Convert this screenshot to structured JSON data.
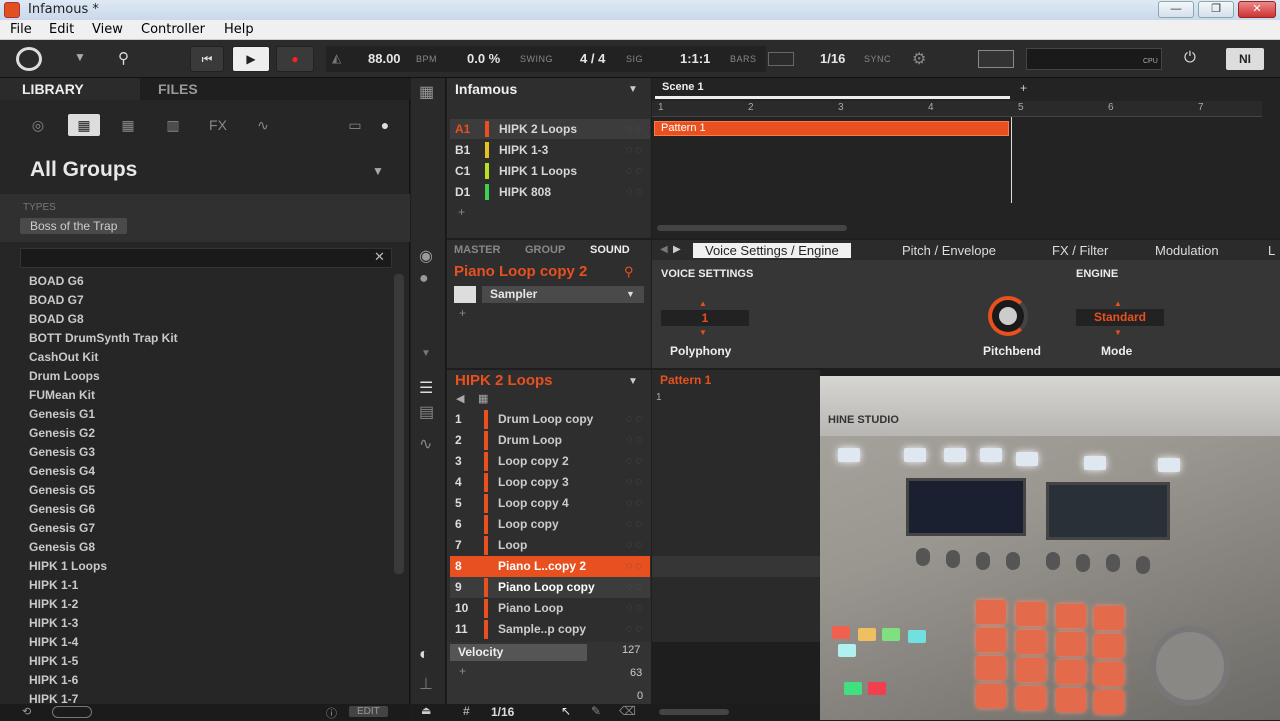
{
  "window": {
    "title": "Infamous *"
  },
  "menu": [
    "File",
    "Edit",
    "View",
    "Controller",
    "Help"
  ],
  "transport": {
    "bpm": "88.00",
    "bpm_label": "BPM",
    "swing": "0.0 %",
    "swing_label": "SWING",
    "sig": "4 / 4",
    "sig_label": "SIG",
    "bars": "1:1:1",
    "bars_label": "BARS",
    "sync": "1/16",
    "sync_label": "SYNC",
    "cpu_label": "CPU"
  },
  "library": {
    "tabs": [
      "LIBRARY",
      "FILES"
    ],
    "heading": "All Groups",
    "types_label": "TYPES",
    "type_tag": "Boss of the Trap",
    "items": [
      "BOAD G6",
      "BOAD G7",
      "BOAD G8",
      "BOTT DrumSynth Trap Kit",
      "CashOut Kit",
      "Drum Loops",
      "FUMean Kit",
      "Genesis G1",
      "Genesis G2",
      "Genesis G3",
      "Genesis G4",
      "Genesis G5",
      "Genesis G6",
      "Genesis G7",
      "Genesis G8",
      "HIPK 1 Loops",
      "HIPK 1-1",
      "HIPK 1-2",
      "HIPK 1-3",
      "HIPK 1-4",
      "HIPK 1-5",
      "HIPK 1-6",
      "HIPK 1-7"
    ],
    "edit_label": "EDIT"
  },
  "project": {
    "title": "Infamous",
    "groups": [
      {
        "id": "A1",
        "name": "HIPK 2 Loops",
        "color": "#e8501f"
      },
      {
        "id": "B1",
        "name": "HIPK 1-3",
        "color": "#e8c01f"
      },
      {
        "id": "C1",
        "name": "HIPK 1 Loops",
        "color": "#b8e01f"
      },
      {
        "id": "D1",
        "name": "HIPK 808",
        "color": "#3fd04f"
      }
    ]
  },
  "arranger": {
    "scene": "Scene 1",
    "ruler": [
      "1",
      "2",
      "3",
      "4",
      "5",
      "6",
      "7"
    ],
    "pattern": "Pattern 1"
  },
  "sound": {
    "tabs": [
      "MASTER",
      "GROUP",
      "SOUND"
    ],
    "name": "Piano Loop copy 2",
    "plugin": "Sampler"
  },
  "params": {
    "tabs": [
      "Voice Settings / Engine",
      "Pitch / Envelope",
      "FX / Filter",
      "Modulation",
      "L"
    ],
    "voice_label": "VOICE SETTINGS",
    "engine_label": "ENGINE",
    "polyphony_value": "1",
    "polyphony_label": "Polyphony",
    "pitchbend_label": "Pitchbend",
    "mode_value": "Standard",
    "mode_label": "Mode"
  },
  "pads": {
    "group_title": "HIPK 2 Loops",
    "items": [
      {
        "num": "1",
        "name": "Drum Loop copy"
      },
      {
        "num": "2",
        "name": "Drum Loop"
      },
      {
        "num": "3",
        "name": "Loop copy 2"
      },
      {
        "num": "4",
        "name": "Loop copy 3"
      },
      {
        "num": "5",
        "name": "Loop copy 4"
      },
      {
        "num": "6",
        "name": "Loop copy"
      },
      {
        "num": "7",
        "name": "Loop"
      },
      {
        "num": "8",
        "name": "Piano L..copy 2"
      },
      {
        "num": "9",
        "name": "Piano Loop copy"
      },
      {
        "num": "10",
        "name": "Piano Loop"
      },
      {
        "num": "11",
        "name": "Sample..p copy"
      }
    ]
  },
  "pattern_editor": {
    "title": "Pattern 1",
    "ruler_start": "1"
  },
  "velocity": {
    "label": "Velocity",
    "max": "127",
    "mid": "63",
    "min": "0"
  },
  "bottom": {
    "grid": "1/16"
  },
  "camera": {
    "brand": "HINE STUDIO"
  }
}
